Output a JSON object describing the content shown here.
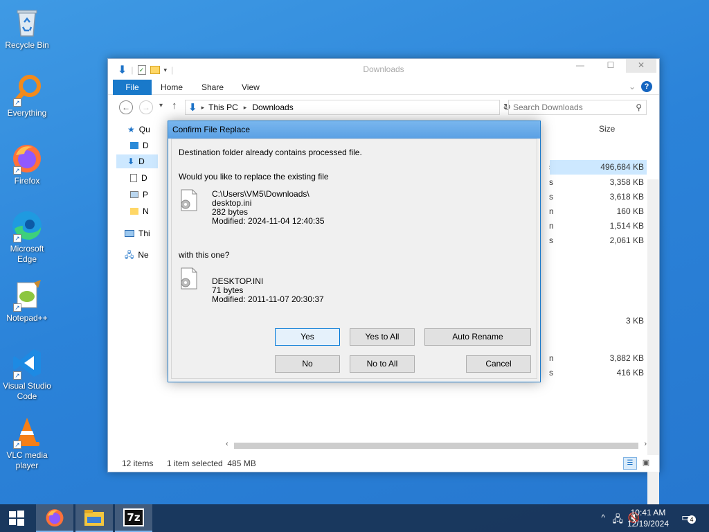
{
  "desktop": {
    "icons": [
      {
        "label": "Recycle Bin",
        "icon": "recycle-bin-icon"
      },
      {
        "label": "Everything",
        "icon": "everything-search-icon"
      },
      {
        "label": "Firefox",
        "icon": "firefox-icon"
      },
      {
        "label": "Microsoft Edge",
        "icon": "edge-icon"
      },
      {
        "label": "Notepad++",
        "icon": "notepad-plus-plus-icon"
      },
      {
        "label": "Visual Studio Code",
        "icon": "vscode-icon"
      },
      {
        "label": "VLC media player",
        "icon": "vlc-icon"
      }
    ]
  },
  "explorer": {
    "title": "Downloads",
    "ribbon": {
      "file": "File",
      "tabs": [
        "Home",
        "Share",
        "View"
      ],
      "help": "?"
    },
    "address": {
      "crumbs": [
        "This PC",
        "Downloads"
      ]
    },
    "search": {
      "placeholder": "Search Downloads"
    },
    "nav": {
      "items": [
        "Qu",
        "D",
        "D",
        "D",
        "P",
        "N",
        "Thi",
        "Ne"
      ]
    },
    "columns": {
      "size": "Size"
    },
    "sizes": [
      {
        "value": "496,684 KB",
        "selected": true
      },
      {
        "value": "3,358 KB"
      },
      {
        "value": "3,618 KB"
      },
      {
        "value": "160 KB"
      },
      {
        "value": "1,514 KB"
      },
      {
        "value": "2,061 KB"
      },
      {
        "value": "3 KB"
      },
      {
        "value": "3,882 KB"
      },
      {
        "value": "416 KB"
      }
    ],
    "status": {
      "items": "12 items",
      "selected": "1 item selected  485 MB"
    }
  },
  "dialog": {
    "title": "Confirm File Replace",
    "line1": "Destination folder already contains processed file.",
    "line2": "Would you like to replace the existing file",
    "existing": {
      "path": "C:\\Users\\VM5\\Downloads\\",
      "name": "desktop.ini",
      "size": "282 bytes",
      "modified": "Modified: 2024-11-04 12:40:35"
    },
    "line3": "with this one?",
    "incoming": {
      "name": "DESKTOP.INI",
      "size": "71 bytes",
      "modified": "Modified: 2011-11-07 20:30:37"
    },
    "buttons": {
      "yes": "Yes",
      "yes_all": "Yes to All",
      "auto_rename": "Auto Rename",
      "no": "No",
      "no_all": "No to All",
      "cancel": "Cancel"
    }
  },
  "taskbar": {
    "time": "10:41 AM",
    "date": "12/19/2024",
    "notifications": "4",
    "apps": [
      "start-icon",
      "firefox-icon",
      "file-explorer-icon",
      "7zip-icon"
    ]
  },
  "colors": {
    "accent": "#1979ca",
    "desktop": "#2b83d9",
    "selection": "#cde8ff"
  }
}
